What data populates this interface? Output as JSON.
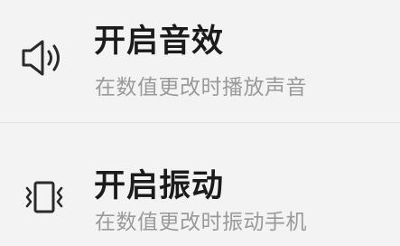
{
  "settings": {
    "items": [
      {
        "icon": "speaker-icon",
        "title": "开启音效",
        "subtitle": "在数值更改时播放声音"
      },
      {
        "icon": "vibrate-icon",
        "title": "开启振动",
        "subtitle": "在数值更改时振动手机"
      }
    ]
  }
}
